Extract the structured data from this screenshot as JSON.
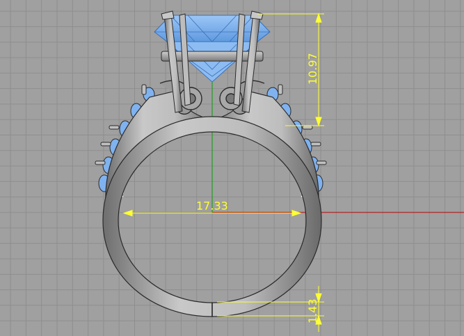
{
  "viewport": {
    "background": "#a0a0a0",
    "grid_color": "#8e8e8e",
    "x_axis_color": "#b22222",
    "y_axis_color": "#1e9e1e",
    "dimension_color": "#ffff33",
    "metal_color": "#b4b4b4",
    "gem_color": "#7fb2ef"
  },
  "dimensions": {
    "inner_diameter": "17.33",
    "setting_height": "10.97",
    "shank_thickness": "1.43"
  }
}
